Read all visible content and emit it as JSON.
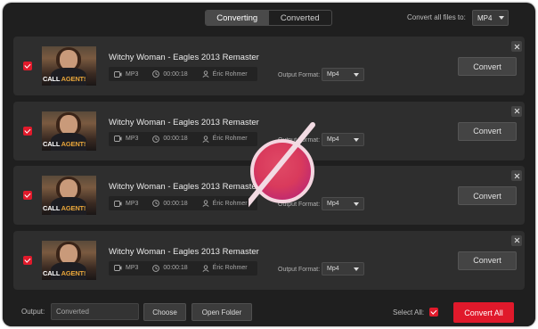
{
  "header": {
    "tabs": [
      {
        "label": "Converting",
        "active": true
      },
      {
        "label": "Converted",
        "active": false
      }
    ],
    "convert_all_label": "Convert all files to:",
    "convert_all_format": "MP4"
  },
  "items": [
    {
      "title": "Witchy Woman - Eagles 2013 Remaster",
      "format": "MP3",
      "duration": "00:00:18",
      "artist": "Éric Rohmer",
      "output_format_label": "Output Format:",
      "output_format": "Mp4",
      "convert_label": "Convert",
      "checked": true,
      "thumb_text": "CALL AGENT!"
    },
    {
      "title": "Witchy Woman - Eagles 2013 Remaster",
      "format": "MP3",
      "duration": "00:00:18",
      "artist": "Éric Rohmer",
      "output_format_label": "Output Format:",
      "output_format": "Mp4",
      "convert_label": "Convert",
      "checked": true,
      "thumb_text": "CALL AGENT!"
    },
    {
      "title": "Witchy Woman - Eagles 2013 Remaster",
      "format": "MP3",
      "duration": "00:00:18",
      "artist": "Éric Rohmer",
      "output_format_label": "Output Format:",
      "output_format": "Mp4",
      "convert_label": "Convert",
      "checked": true,
      "thumb_text": "CALL AGENT!"
    },
    {
      "title": "Witchy Woman - Eagles 2013 Remaster",
      "format": "MP3",
      "duration": "00:00:18",
      "artist": "Éric Rohmer",
      "output_format_label": "Output Format:",
      "output_format": "Mp4",
      "convert_label": "Convert",
      "checked": true,
      "thumb_text": "CALL AGENT!"
    }
  ],
  "footer": {
    "output_label": "Output:",
    "output_value": "Converted",
    "choose_label": "Choose",
    "open_folder_label": "Open Folder",
    "select_all_label": "Select All:",
    "select_all_checked": true,
    "convert_all_button": "Convert All"
  },
  "colors": {
    "accent": "#e0192b",
    "background": "#1f1f1f",
    "row_background": "#2e2e2e"
  },
  "icons": {
    "format": "video-icon",
    "duration": "clock-icon",
    "artist": "user-icon",
    "close": "close-icon",
    "overlay": "prohibited-icon"
  }
}
